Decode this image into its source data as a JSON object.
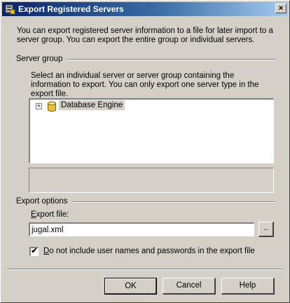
{
  "window": {
    "title": "Export Registered Servers",
    "close_glyph": "×"
  },
  "intro_text": "You can export registered server information to a file for later import to a server group. You can export the entire group or individual servers.",
  "server_group": {
    "heading": "Server group",
    "description": "Select an individual server or server group containing the information to export. You can only export one server type in the export file.",
    "tree": {
      "items": [
        {
          "label": "Database Engine",
          "expander": "+",
          "icon": "database-cylinder-icon",
          "selected": true
        }
      ]
    }
  },
  "export_options": {
    "heading": "Export options",
    "file_label_access_key": "E",
    "file_label_rest": "xport file:",
    "file_value": "jugal.xml",
    "browse_label": "..",
    "checkbox_checked": true,
    "checkbox_mark": "✔",
    "checkbox_label_access_key": "D",
    "checkbox_label_rest": "o not include user names and passwords in the export file"
  },
  "buttons": {
    "ok": "OK",
    "cancel": "Cancel",
    "help": "Help"
  },
  "colors": {
    "dialog_face": "#d4d0c8",
    "title_gradient_start": "#0a246a",
    "title_gradient_end": "#a6caf0",
    "db_icon": "#e8c040"
  }
}
